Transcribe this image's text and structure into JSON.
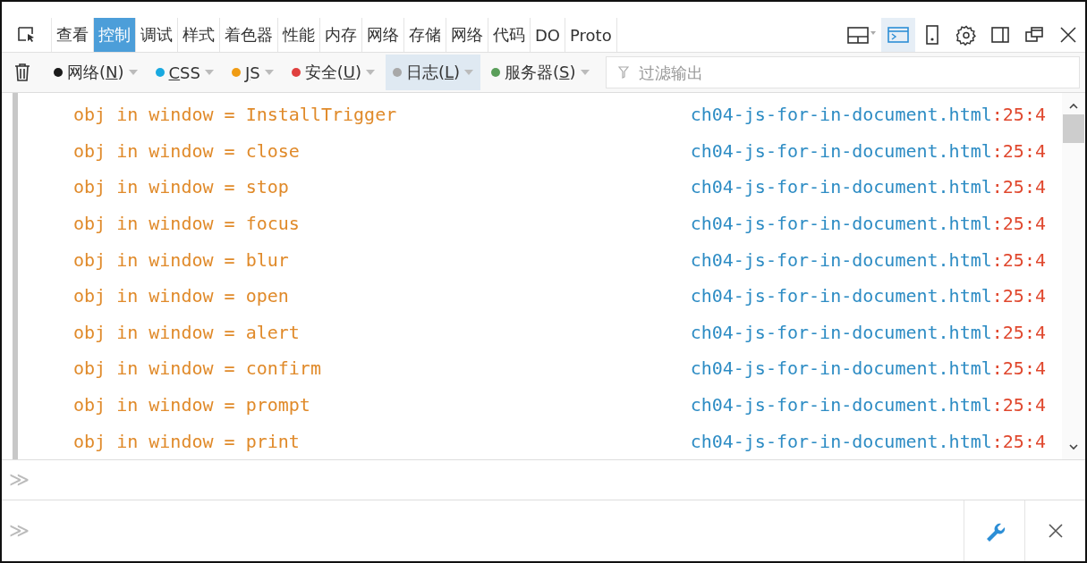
{
  "tabs": [
    {
      "label": "查看",
      "selected": false
    },
    {
      "label": "控制",
      "selected": true
    },
    {
      "label": "调试",
      "selected": false
    },
    {
      "label": "样式",
      "selected": false
    },
    {
      "label": "着色器",
      "selected": false
    },
    {
      "label": "性能",
      "selected": false
    },
    {
      "label": "内存",
      "selected": false
    },
    {
      "label": "网络",
      "selected": false
    },
    {
      "label": "存储",
      "selected": false
    },
    {
      "label": "网络",
      "selected": false
    },
    {
      "label": "代码",
      "selected": false
    },
    {
      "label": "DO",
      "selected": false
    },
    {
      "label": "Proto",
      "selected": false
    }
  ],
  "filters": [
    {
      "before": "网络(",
      "key": "N",
      "after": ")",
      "color": "#1a1a1a",
      "selected": false
    },
    {
      "key": "C",
      "after": "SS",
      "color": "#19a9e0",
      "selected": false
    },
    {
      "key": "J",
      "after": "S",
      "color": "#f09c14",
      "selected": false
    },
    {
      "before": "安全(",
      "key": "U",
      "after": ")",
      "color": "#e0403f",
      "selected": false
    },
    {
      "before": "日志(",
      "key": "L",
      "after": ")",
      "color": "#a8a8a8",
      "selected": true
    },
    {
      "before": "服务器(",
      "key": "S",
      "after": ")",
      "color": "#5a9e5a",
      "selected": false
    }
  ],
  "filter_search": {
    "placeholder": "过滤输出"
  },
  "console_rows": [
    {
      "message": "obj in window = InstallTrigger",
      "source": "ch04-js-for-in-document.html",
      "location": ":25:4"
    },
    {
      "message": "obj in window = close",
      "source": "ch04-js-for-in-document.html",
      "location": ":25:4"
    },
    {
      "message": "obj in window = stop",
      "source": "ch04-js-for-in-document.html",
      "location": ":25:4"
    },
    {
      "message": "obj in window = focus",
      "source": "ch04-js-for-in-document.html",
      "location": ":25:4"
    },
    {
      "message": "obj in window = blur",
      "source": "ch04-js-for-in-document.html",
      "location": ":25:4"
    },
    {
      "message": "obj in window = open",
      "source": "ch04-js-for-in-document.html",
      "location": ":25:4"
    },
    {
      "message": "obj in window = alert",
      "source": "ch04-js-for-in-document.html",
      "location": ":25:4"
    },
    {
      "message": "obj in window = confirm",
      "source": "ch04-js-for-in-document.html",
      "location": ":25:4"
    },
    {
      "message": "obj in window = prompt",
      "source": "ch04-js-for-in-document.html",
      "location": ":25:4"
    },
    {
      "message": "obj in window = print",
      "source": "ch04-js-for-in-document.html",
      "location": ":25:4"
    }
  ],
  "command_line": {
    "prompt": "≫"
  },
  "multiline_input": {
    "prompt": "≫"
  }
}
